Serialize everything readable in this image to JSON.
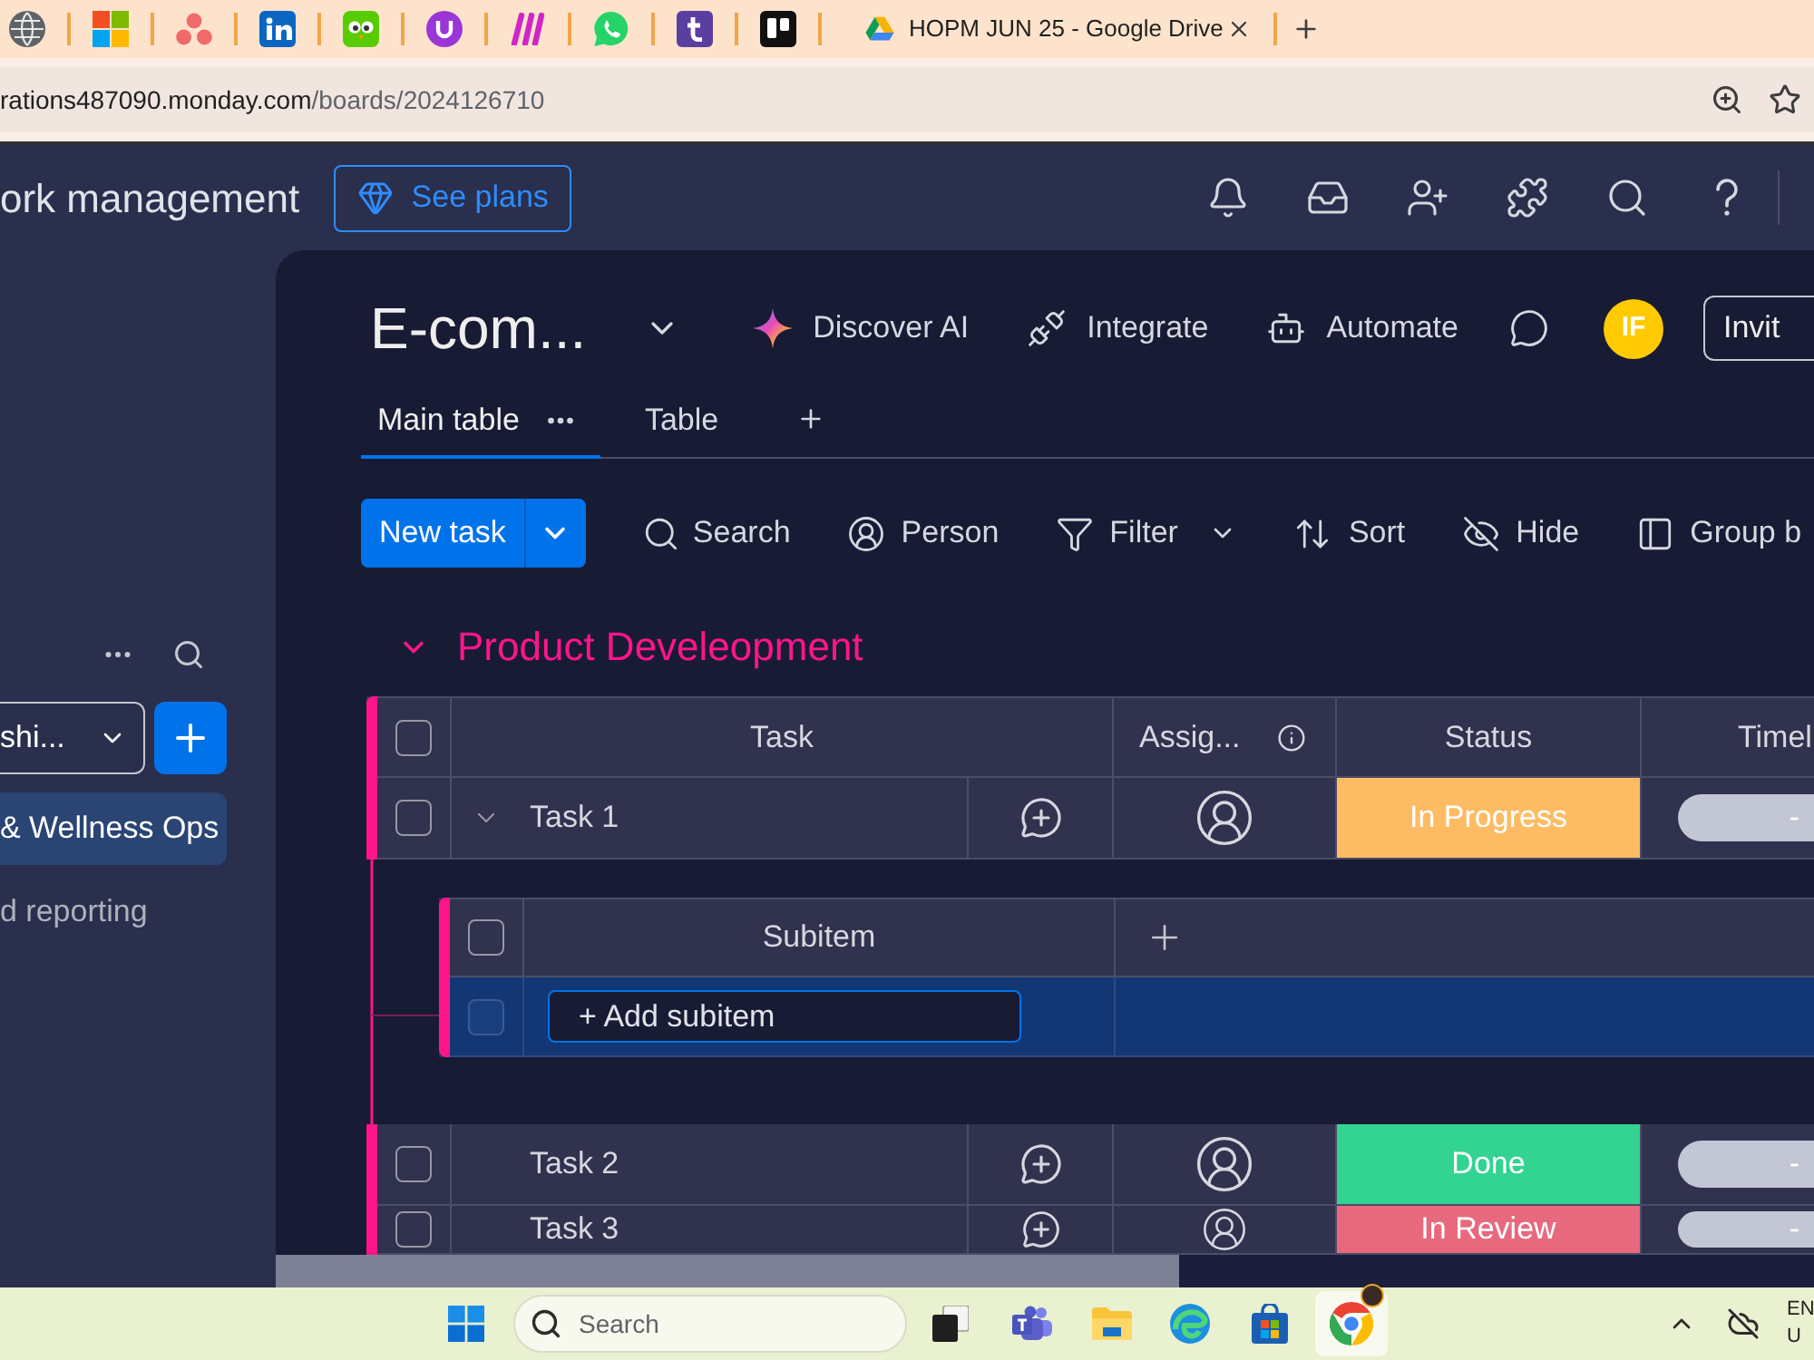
{
  "browser": {
    "active_tab": {
      "title": "HOPM JUN 25 - Google Drive"
    },
    "address": {
      "host": "rations487090.monday.com",
      "path": "/boards/2024126710"
    }
  },
  "header": {
    "product": "ork management",
    "plans_button": "See plans"
  },
  "sidebar": {
    "workspace": "shi...",
    "items": [
      {
        "label": "& Wellness Ops",
        "selected": true
      },
      {
        "label": "d reporting",
        "selected": false
      }
    ]
  },
  "board": {
    "title": "E-com...",
    "actions": [
      "Discover AI",
      "Integrate",
      "Automate"
    ],
    "avatar": "IF",
    "invite_button": "Invit",
    "views": [
      {
        "label": "Main table",
        "selected": true
      },
      {
        "label": "Table",
        "selected": false
      }
    ],
    "new_task_button": "New task",
    "tools": [
      {
        "label": "Search",
        "dropdown": false
      },
      {
        "label": "Person",
        "dropdown": false
      },
      {
        "label": "Filter",
        "dropdown": true
      },
      {
        "label": "Sort",
        "dropdown": false
      },
      {
        "label": "Hide",
        "dropdown": false
      },
      {
        "label": "Group b",
        "dropdown": false
      }
    ]
  },
  "group": {
    "title": "Product Develeopment",
    "expanded": true,
    "all_checked": false,
    "columns": [
      "Task",
      "Assig...",
      "Status",
      "Timel"
    ],
    "rows": [
      {
        "task": "Task 1",
        "checked": false,
        "expanded": true,
        "status": "In Progress",
        "color": "#fdbc64",
        "timeline": "-",
        "subitems": {
          "column": "Subitem",
          "all_checked": false,
          "new_row": {
            "checked": false,
            "placeholder": "+ Add subitem"
          }
        }
      },
      {
        "task": "Task 2",
        "checked": false,
        "status": "Done",
        "color": "#33d391",
        "timeline": "-"
      },
      {
        "task": "Task 3",
        "checked": false,
        "status": "In Review",
        "color": "#e8697d",
        "timeline": "-"
      }
    ]
  },
  "taskbar": {
    "search": {
      "placeholder": "Search"
    },
    "language": [
      "EN",
      "U"
    ]
  }
}
